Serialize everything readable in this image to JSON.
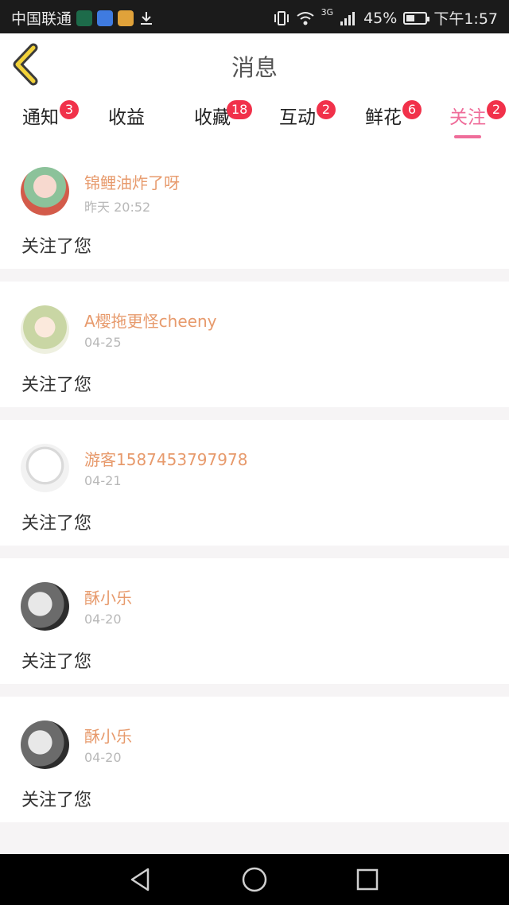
{
  "status_bar": {
    "carrier": "中国联通",
    "network": "3G",
    "battery_text": "45%",
    "battery_level": 0.45,
    "time": "下午1:57"
  },
  "header": {
    "title": "消息"
  },
  "tabs": [
    {
      "label": "通知",
      "badge": "3"
    },
    {
      "label": "收益",
      "badge": ""
    },
    {
      "label": "收藏",
      "badge": "18"
    },
    {
      "label": "互动",
      "badge": "2"
    },
    {
      "label": "鲜花",
      "badge": "6"
    },
    {
      "label": "关注",
      "badge": "2"
    }
  ],
  "active_tab": "关注",
  "messages": [
    {
      "name": "锦鲤油炸了呀",
      "time": "昨天 20:52",
      "action": "关注了您"
    },
    {
      "name": "A樱拖更怪cheeny",
      "time": "04-25",
      "action": "关注了您"
    },
    {
      "name": "游客1587453797978",
      "time": "04-21",
      "action": "关注了您"
    },
    {
      "name": "酥小乐",
      "time": "04-20",
      "action": "关注了您"
    },
    {
      "name": "酥小乐",
      "time": "04-20",
      "action": "关注了您"
    }
  ],
  "colors": {
    "accent": "#ef6d9a",
    "badge": "#f1314a",
    "username": "#e79a6c",
    "back_arrow": "#f2d23a"
  }
}
